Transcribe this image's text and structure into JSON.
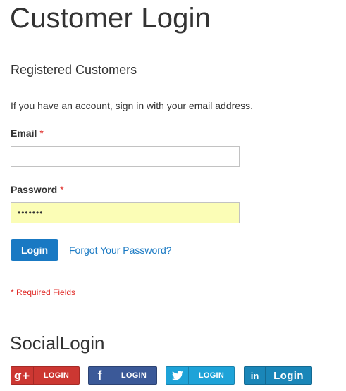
{
  "page": {
    "title": "Customer Login"
  },
  "registered": {
    "title": "Registered Customers",
    "note": "If you have an account, sign in with your email address.",
    "email_label": "Email",
    "email_value": "",
    "password_label": "Password",
    "password_value": "•••••••",
    "required_marker": "*",
    "login_label": "Login",
    "forgot_label": "Forgot Your Password?",
    "required_note": "* Required Fields"
  },
  "social": {
    "title": "SocialLogin",
    "buttons": [
      {
        "provider": "google",
        "icon": "google-plus-icon",
        "icon_text": "g+",
        "label": "LOGIN",
        "color": "#cc3732"
      },
      {
        "provider": "facebook",
        "icon": "facebook-icon",
        "icon_text": "f",
        "label": "LOGIN",
        "color": "#3b5998"
      },
      {
        "provider": "twitter",
        "icon": "twitter-bird-icon",
        "label": "LOGIN",
        "color": "#1ea3d8"
      },
      {
        "provider": "linkedin",
        "icon": "linkedin-icon",
        "icon_text": "in",
        "label": "Login",
        "color": "#1a86b8"
      }
    ]
  },
  "colors": {
    "primary": "#1979c3",
    "required": "#e02b27",
    "autofill": "#fbfdb6"
  }
}
